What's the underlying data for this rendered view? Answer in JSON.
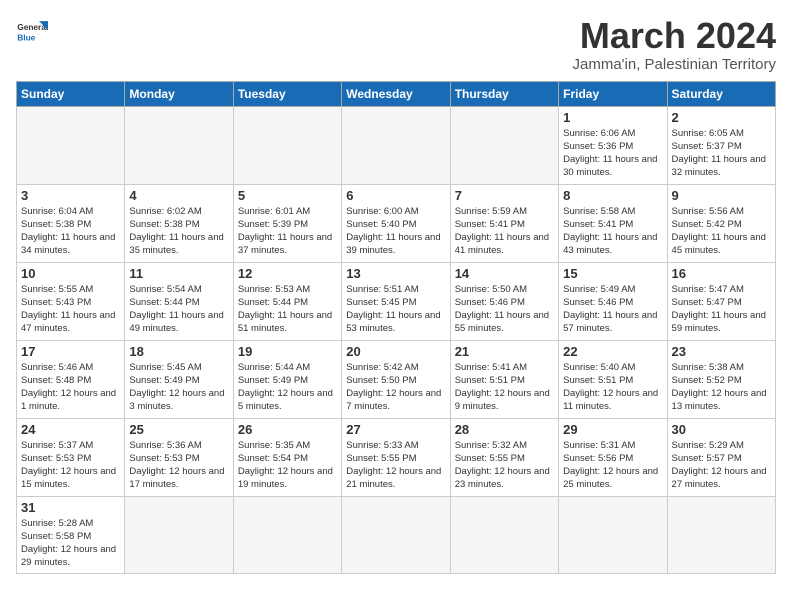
{
  "logo": {
    "line1": "General",
    "line2": "Blue"
  },
  "title": "March 2024",
  "subtitle": "Jamma'in, Palestinian Territory",
  "days_of_week": [
    "Sunday",
    "Monday",
    "Tuesday",
    "Wednesday",
    "Thursday",
    "Friday",
    "Saturday"
  ],
  "weeks": [
    [
      {
        "day": "",
        "info": ""
      },
      {
        "day": "",
        "info": ""
      },
      {
        "day": "",
        "info": ""
      },
      {
        "day": "",
        "info": ""
      },
      {
        "day": "",
        "info": ""
      },
      {
        "day": "1",
        "info": "Sunrise: 6:06 AM\nSunset: 5:36 PM\nDaylight: 11 hours\nand 30 minutes."
      },
      {
        "day": "2",
        "info": "Sunrise: 6:05 AM\nSunset: 5:37 PM\nDaylight: 11 hours\nand 32 minutes."
      }
    ],
    [
      {
        "day": "3",
        "info": "Sunrise: 6:04 AM\nSunset: 5:38 PM\nDaylight: 11 hours\nand 34 minutes."
      },
      {
        "day": "4",
        "info": "Sunrise: 6:02 AM\nSunset: 5:38 PM\nDaylight: 11 hours\nand 35 minutes."
      },
      {
        "day": "5",
        "info": "Sunrise: 6:01 AM\nSunset: 5:39 PM\nDaylight: 11 hours\nand 37 minutes."
      },
      {
        "day": "6",
        "info": "Sunrise: 6:00 AM\nSunset: 5:40 PM\nDaylight: 11 hours\nand 39 minutes."
      },
      {
        "day": "7",
        "info": "Sunrise: 5:59 AM\nSunset: 5:41 PM\nDaylight: 11 hours\nand 41 minutes."
      },
      {
        "day": "8",
        "info": "Sunrise: 5:58 AM\nSunset: 5:41 PM\nDaylight: 11 hours\nand 43 minutes."
      },
      {
        "day": "9",
        "info": "Sunrise: 5:56 AM\nSunset: 5:42 PM\nDaylight: 11 hours\nand 45 minutes."
      }
    ],
    [
      {
        "day": "10",
        "info": "Sunrise: 5:55 AM\nSunset: 5:43 PM\nDaylight: 11 hours\nand 47 minutes."
      },
      {
        "day": "11",
        "info": "Sunrise: 5:54 AM\nSunset: 5:44 PM\nDaylight: 11 hours\nand 49 minutes."
      },
      {
        "day": "12",
        "info": "Sunrise: 5:53 AM\nSunset: 5:44 PM\nDaylight: 11 hours\nand 51 minutes."
      },
      {
        "day": "13",
        "info": "Sunrise: 5:51 AM\nSunset: 5:45 PM\nDaylight: 11 hours\nand 53 minutes."
      },
      {
        "day": "14",
        "info": "Sunrise: 5:50 AM\nSunset: 5:46 PM\nDaylight: 11 hours\nand 55 minutes."
      },
      {
        "day": "15",
        "info": "Sunrise: 5:49 AM\nSunset: 5:46 PM\nDaylight: 11 hours\nand 57 minutes."
      },
      {
        "day": "16",
        "info": "Sunrise: 5:47 AM\nSunset: 5:47 PM\nDaylight: 11 hours\nand 59 minutes."
      }
    ],
    [
      {
        "day": "17",
        "info": "Sunrise: 5:46 AM\nSunset: 5:48 PM\nDaylight: 12 hours\nand 1 minute."
      },
      {
        "day": "18",
        "info": "Sunrise: 5:45 AM\nSunset: 5:49 PM\nDaylight: 12 hours\nand 3 minutes."
      },
      {
        "day": "19",
        "info": "Sunrise: 5:44 AM\nSunset: 5:49 PM\nDaylight: 12 hours\nand 5 minutes."
      },
      {
        "day": "20",
        "info": "Sunrise: 5:42 AM\nSunset: 5:50 PM\nDaylight: 12 hours\nand 7 minutes."
      },
      {
        "day": "21",
        "info": "Sunrise: 5:41 AM\nSunset: 5:51 PM\nDaylight: 12 hours\nand 9 minutes."
      },
      {
        "day": "22",
        "info": "Sunrise: 5:40 AM\nSunset: 5:51 PM\nDaylight: 12 hours\nand 11 minutes."
      },
      {
        "day": "23",
        "info": "Sunrise: 5:38 AM\nSunset: 5:52 PM\nDaylight: 12 hours\nand 13 minutes."
      }
    ],
    [
      {
        "day": "24",
        "info": "Sunrise: 5:37 AM\nSunset: 5:53 PM\nDaylight: 12 hours\nand 15 minutes."
      },
      {
        "day": "25",
        "info": "Sunrise: 5:36 AM\nSunset: 5:53 PM\nDaylight: 12 hours\nand 17 minutes."
      },
      {
        "day": "26",
        "info": "Sunrise: 5:35 AM\nSunset: 5:54 PM\nDaylight: 12 hours\nand 19 minutes."
      },
      {
        "day": "27",
        "info": "Sunrise: 5:33 AM\nSunset: 5:55 PM\nDaylight: 12 hours\nand 21 minutes."
      },
      {
        "day": "28",
        "info": "Sunrise: 5:32 AM\nSunset: 5:55 PM\nDaylight: 12 hours\nand 23 minutes."
      },
      {
        "day": "29",
        "info": "Sunrise: 5:31 AM\nSunset: 5:56 PM\nDaylight: 12 hours\nand 25 minutes."
      },
      {
        "day": "30",
        "info": "Sunrise: 5:29 AM\nSunset: 5:57 PM\nDaylight: 12 hours\nand 27 minutes."
      }
    ],
    [
      {
        "day": "31",
        "info": "Sunrise: 5:28 AM\nSunset: 5:58 PM\nDaylight: 12 hours\nand 29 minutes."
      },
      {
        "day": "",
        "info": ""
      },
      {
        "day": "",
        "info": ""
      },
      {
        "day": "",
        "info": ""
      },
      {
        "day": "",
        "info": ""
      },
      {
        "day": "",
        "info": ""
      },
      {
        "day": "",
        "info": ""
      }
    ]
  ]
}
